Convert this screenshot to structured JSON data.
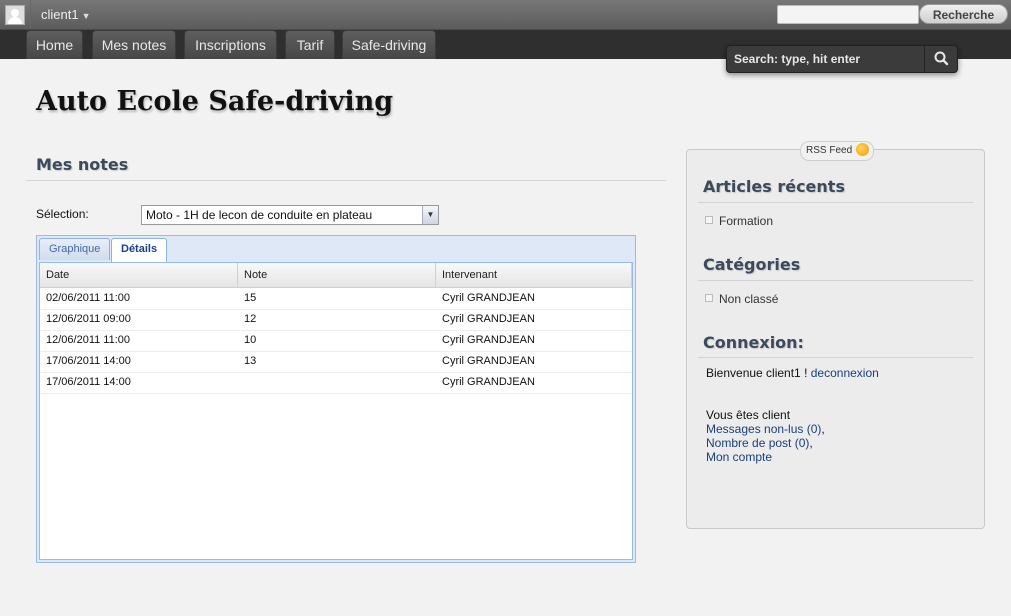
{
  "admin_bar": {
    "user": "client1",
    "search_button": "Recherche",
    "search_value": ""
  },
  "nav": {
    "tabs": [
      {
        "label": "Home"
      },
      {
        "label": "Mes notes"
      },
      {
        "label": "Inscriptions"
      },
      {
        "label": "Tarif"
      },
      {
        "label": "Safe-driving"
      }
    ],
    "search_placeholder": "Search: type, hit enter"
  },
  "site_title": "Auto Ecole Safe-driving",
  "page": {
    "title": "Mes notes",
    "selection_label": "Sélection:",
    "selection_value": "Moto - 1H de lecon de conduite en plateau",
    "tabs": [
      "Graphique",
      "Détails"
    ],
    "active_tab": "Détails",
    "grid": {
      "columns": [
        "Date",
        "Note",
        "Intervenant"
      ],
      "rows": [
        [
          "02/06/2011 11:00",
          "15",
          "Cyril GRANDJEAN"
        ],
        [
          "12/06/2011 09:00",
          "12",
          "Cyril GRANDJEAN"
        ],
        [
          "12/06/2011 11:00",
          "10",
          "Cyril GRANDJEAN"
        ],
        [
          "17/06/2011 14:00",
          "13",
          "Cyril GRANDJEAN"
        ],
        [
          "17/06/2011 14:00",
          "",
          "Cyril GRANDJEAN"
        ]
      ]
    }
  },
  "sidebar": {
    "rss_label": "RSS Feed",
    "recent_title": "Articles récents",
    "recent_items": [
      "Formation"
    ],
    "categories_title": "Catégories",
    "categories_items": [
      "Non classé"
    ],
    "connexion_title": "Connexion:",
    "welcome_text": "Bienvenue client1 ! ",
    "logout_link": "deconnexion",
    "status_text": "Vous êtes client",
    "messages_link": "Messages non-lus (0)",
    "posts_link": "Nombre de post (0)",
    "account_link": "Mon compte",
    "comma": ","
  }
}
